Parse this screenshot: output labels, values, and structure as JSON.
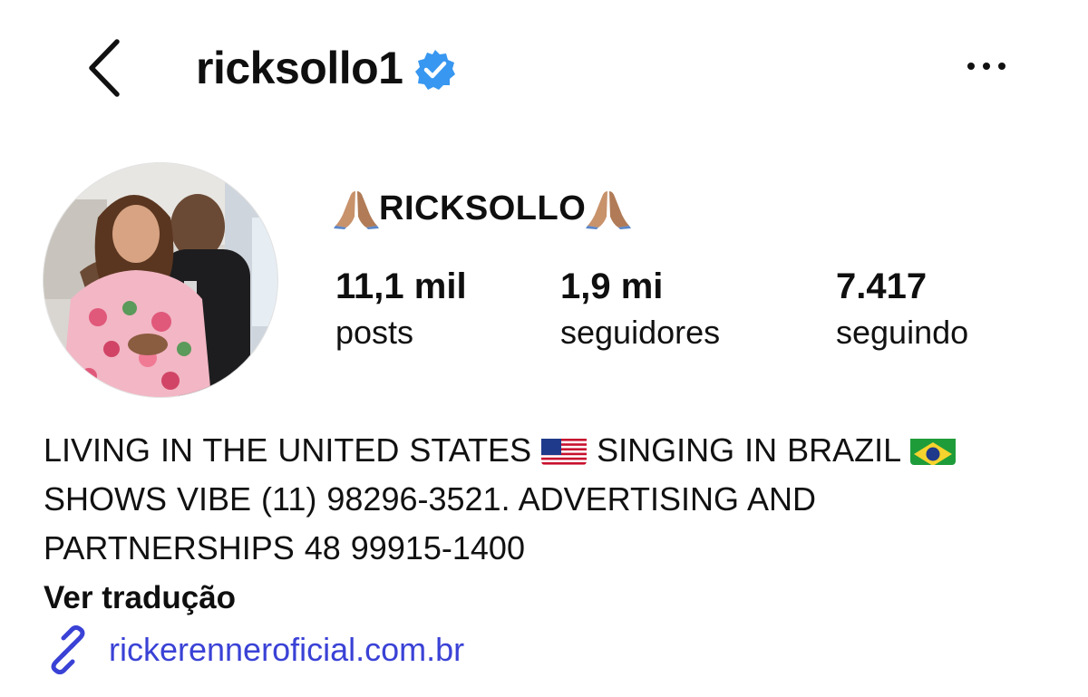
{
  "header": {
    "back_icon": "chevron-left-icon",
    "username": "ricksollo1",
    "verified_icon": "verified-badge-icon",
    "more_icon": "ellipsis-horizontal-icon"
  },
  "profile": {
    "display_name_prefix_icon": "folded-hands-icon",
    "display_name": "RICKSOLLO",
    "display_name_suffix_icon": "folded-hands-icon",
    "stats": [
      {
        "value": "11,1 mil",
        "label": "posts"
      },
      {
        "value": "1,9 mi",
        "label": "seguidores"
      },
      {
        "value": "7.417",
        "label": "seguindo"
      }
    ]
  },
  "bio": {
    "part1": "LIVING IN THE UNITED STATES ",
    "flag1": "us-flag-icon",
    "part2": " SINGING IN BRAZIL ",
    "flag2": "brazil-flag-icon",
    "part3": " SHOWS VIBE (11) 98296-3521. ADVERTISING AND PARTNERSHIPS 48 99915-1400",
    "translate_label": "Ver tradução",
    "link_icon": "link-icon",
    "link_text": "rickerenneroficial.com.br"
  },
  "colors": {
    "verified_blue": "#3897f0",
    "link_blue": "#3a42d6",
    "text": "#0f0f0f"
  }
}
